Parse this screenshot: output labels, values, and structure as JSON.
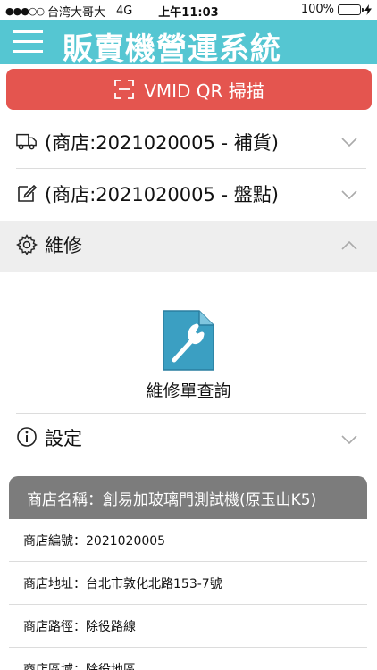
{
  "status_bar": {
    "signal": "●●●○○",
    "carrier": "台湾大哥大",
    "network": "4G",
    "time": "上午11:03",
    "battery": "100%",
    "battery_level": 1.0
  },
  "header": {
    "title": "販賣機營運系統"
  },
  "scan_button": {
    "label": "VMID QR 掃描"
  },
  "sections": {
    "restock": "(商店:2021020005 - 補貨)",
    "inventory": "(商店:2021020005 - 盤點)",
    "repair": "維修",
    "repair_query": "維修單查詢",
    "settings": "設定"
  },
  "store_card": {
    "name": "商店名稱：創易加玻璃門測試機(原玉山K5)",
    "number": "商店編號：2021020005",
    "address": "商店地址：台北市敦化北路153-7號",
    "route": "商店路徑：除役路線",
    "area": "商店區域：除役地區"
  },
  "colors": {
    "header": "#55c6d2",
    "scan_button": "#e4554f",
    "card_header": "#7c7c7c",
    "doc_icon": "#3b9fc2"
  }
}
